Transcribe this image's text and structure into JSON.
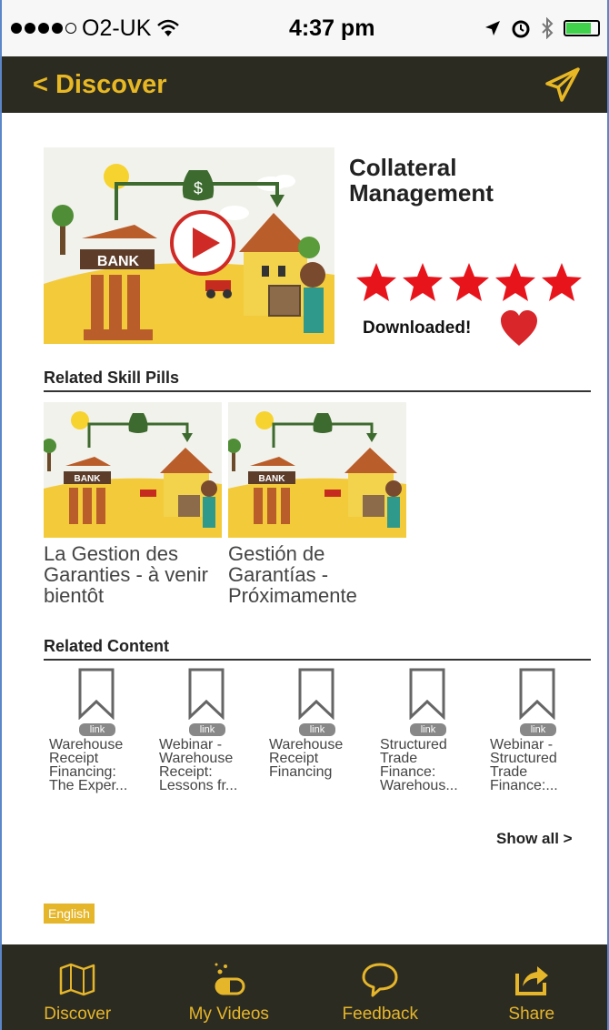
{
  "status_bar": {
    "carrier": "O2-UK",
    "time": "4:37 pm",
    "battery_level": 0.8
  },
  "nav": {
    "back_label": "< Discover",
    "send_icon": "paper-plane-icon"
  },
  "video": {
    "title": "Collateral Management",
    "rating": 5,
    "max_rating": 5,
    "downloaded_label": "Downloaded!",
    "thumb_bank_label": "BANK",
    "thumb_icons": [
      "play-icon",
      "money-bag-icon",
      "heart-icon"
    ]
  },
  "related_skill_pills": {
    "header": "Related Skill Pills",
    "items": [
      {
        "title": "La Gestion des Garanties - à venir bientôt",
        "bank_label": "BANK"
      },
      {
        "title": "Gestión de Garantías - Próximamente",
        "bank_label": "BANK"
      }
    ]
  },
  "related_content": {
    "header": "Related Content",
    "badge": "link",
    "items": [
      {
        "title": "Warehouse\nReceipt\nFinancing:\nThe Exper..."
      },
      {
        "title": "Webinar -\nWarehouse\nReceipt:\nLessons fr..."
      },
      {
        "title": "Warehouse\nReceipt\nFinancing"
      },
      {
        "title": "Structured\nTrade\nFinance:\nWarehous..."
      },
      {
        "title": "Webinar -\nStructured\nTrade\nFinance:..."
      }
    ],
    "show_all_label": "Show all >"
  },
  "language_badge": "English",
  "tabs": [
    {
      "label": "Discover",
      "icon": "map-icon"
    },
    {
      "label": "My Videos",
      "icon": "pill-icon"
    },
    {
      "label": "Feedback",
      "icon": "speech-bubble-icon"
    },
    {
      "label": "Share",
      "icon": "share-icon"
    }
  ],
  "colors": {
    "accent": "#e6b62a",
    "bar": "#2b2b22",
    "star": "#e8141c"
  }
}
